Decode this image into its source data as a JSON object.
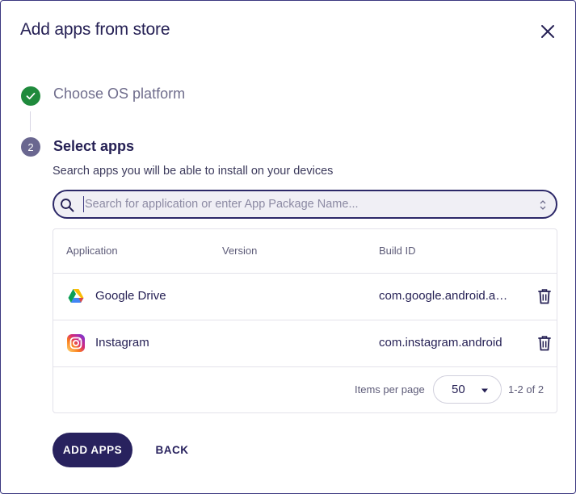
{
  "dialog": {
    "title": "Add apps from store"
  },
  "steps": [
    {
      "number": "",
      "label": "Choose OS platform",
      "status": "completed"
    },
    {
      "number": "2",
      "label": "Select apps",
      "status": "active",
      "description": "Search apps you will be able to install on your devices"
    }
  ],
  "search": {
    "placeholder": "Search for application or enter App Package Name...",
    "value": ""
  },
  "table": {
    "columns": [
      "Application",
      "Version",
      "Build ID"
    ],
    "rows": [
      {
        "icon": "google-drive-icon",
        "application": "Google Drive",
        "version": "",
        "build_id": "com.google.android.apps.docs"
      },
      {
        "icon": "instagram-icon",
        "application": "Instagram",
        "version": "",
        "build_id": "com.instagram.android"
      }
    ],
    "pagination": {
      "items_per_page_label": "Items per page",
      "items_per_page": "50",
      "range": "1-2 of 2"
    }
  },
  "actions": {
    "add_label": "ADD APPS",
    "back_label": "BACK"
  },
  "colors": {
    "primary": "#28225e",
    "success": "#1f8a3c",
    "step_inactive": "#6a6790"
  }
}
